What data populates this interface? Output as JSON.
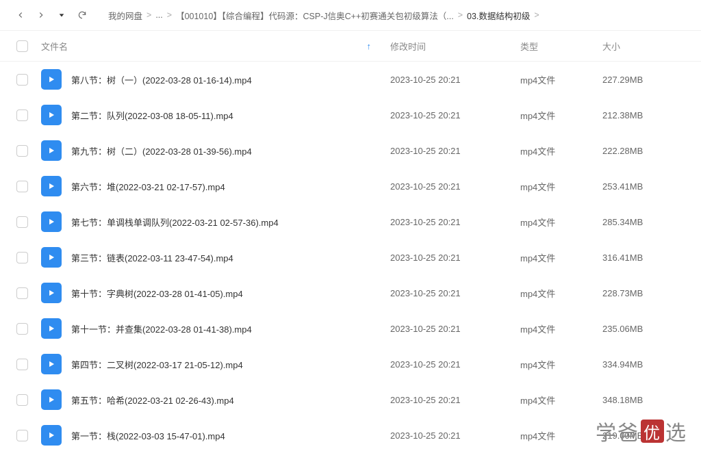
{
  "breadcrumb": {
    "root": "我的网盘",
    "ellipsis": "...",
    "folder1": "【001010】【综合编程】代码源：CSP-J信奥C++初赛通关包初级算法（...",
    "folder2": "03.数据结构初级"
  },
  "columns": {
    "name": "文件名",
    "mtime": "修改时间",
    "type": "类型",
    "size": "大小",
    "sort_indicator": "↑"
  },
  "files": [
    {
      "name": "第八节：树（一）(2022-03-28 01-16-14).mp4",
      "mtime": "2023-10-25 20:21",
      "type": "mp4文件",
      "size": "227.29MB"
    },
    {
      "name": "第二节：队列(2022-03-08 18-05-11).mp4",
      "mtime": "2023-10-25 20:21",
      "type": "mp4文件",
      "size": "212.38MB"
    },
    {
      "name": "第九节：树（二）(2022-03-28 01-39-56).mp4",
      "mtime": "2023-10-25 20:21",
      "type": "mp4文件",
      "size": "222.28MB"
    },
    {
      "name": "第六节：堆(2022-03-21 02-17-57).mp4",
      "mtime": "2023-10-25 20:21",
      "type": "mp4文件",
      "size": "253.41MB"
    },
    {
      "name": "第七节：单调栈单调队列(2022-03-21 02-57-36).mp4",
      "mtime": "2023-10-25 20:21",
      "type": "mp4文件",
      "size": "285.34MB"
    },
    {
      "name": "第三节：链表(2022-03-11 23-47-54).mp4",
      "mtime": "2023-10-25 20:21",
      "type": "mp4文件",
      "size": "316.41MB"
    },
    {
      "name": "第十节：字典树(2022-03-28 01-41-05).mp4",
      "mtime": "2023-10-25 20:21",
      "type": "mp4文件",
      "size": "228.73MB"
    },
    {
      "name": "第十一节：并查集(2022-03-28 01-41-38).mp4",
      "mtime": "2023-10-25 20:21",
      "type": "mp4文件",
      "size": "235.06MB"
    },
    {
      "name": "第四节：二叉树(2022-03-17 21-05-12).mp4",
      "mtime": "2023-10-25 20:21",
      "type": "mp4文件",
      "size": "334.94MB"
    },
    {
      "name": "第五节：哈希(2022-03-21 02-26-43).mp4",
      "mtime": "2023-10-25 20:21",
      "type": "mp4文件",
      "size": "348.18MB"
    },
    {
      "name": "第一节：栈(2022-03-03 15-47-01).mp4",
      "mtime": "2023-10-25 20:21",
      "type": "mp4文件",
      "size": "219.00MB"
    }
  ],
  "watermark": {
    "a": "学爸",
    "b": "优",
    "c": "选"
  }
}
